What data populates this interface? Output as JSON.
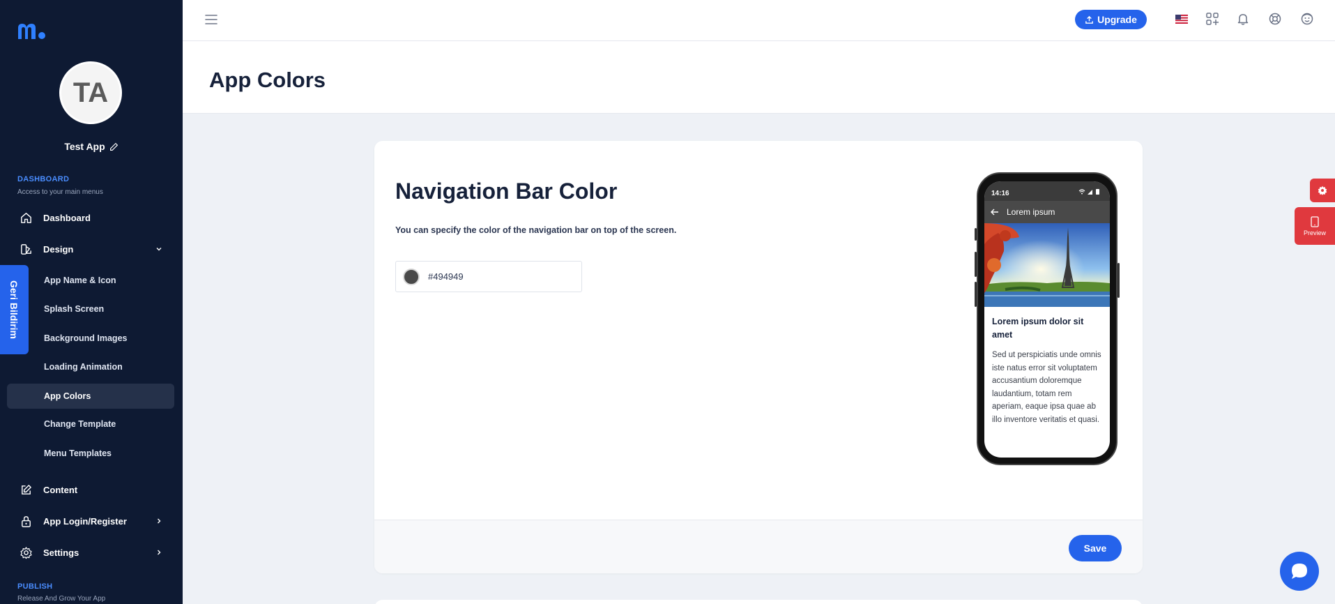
{
  "app": {
    "avatar_initials": "TA",
    "name": "Test App"
  },
  "sidebar": {
    "dashboard_section": {
      "title": "DASHBOARD",
      "subtitle": "Access to your main menus"
    },
    "items": [
      {
        "label": "Dashboard",
        "icon": "home-icon"
      },
      {
        "label": "Design",
        "icon": "design-icon"
      },
      {
        "label": "Content",
        "icon": "edit-icon"
      },
      {
        "label": "App Login/Register",
        "icon": "lock-icon"
      },
      {
        "label": "Settings",
        "icon": "gear-icon"
      }
    ],
    "design_subitems": [
      "App Name & Icon",
      "Splash Screen",
      "Background Images",
      "Loading Animation",
      "App Colors",
      "Change Template",
      "Menu Templates"
    ],
    "publish_section": {
      "title": "PUBLISH",
      "subtitle": "Release And Grow Your App"
    }
  },
  "feedback_tab": {
    "label": "Geri Bildirim"
  },
  "topbar": {
    "upgrade_label": "Upgrade",
    "icons": [
      "menu-icon",
      "us-flag-icon",
      "apps-add-icon",
      "bell-icon",
      "support-icon",
      "user-icon"
    ]
  },
  "page": {
    "title": "App Colors"
  },
  "card": {
    "title": "Navigation Bar Color",
    "description": "You can specify the color of the navigation bar on top of the screen.",
    "color_value": "#494949",
    "save_label": "Save"
  },
  "phone_preview": {
    "time": "14:16",
    "nav_title": "Lorem ipsum",
    "article_title": "Lorem ipsum dolor sit amet",
    "article_body": "Sed ut perspiciatis unde omnis iste natus error sit voluptatem accusantium doloremque laudantium, totam rem aperiam, eaque ipsa quae ab illo inventore veritatis et quasi.",
    "nav_color": "#494949"
  },
  "floating": {
    "preview_label": "Preview"
  },
  "colors": {
    "sidebar_bg": "#0e1a33",
    "accent": "#2563eb",
    "danger": "#e0393e"
  }
}
